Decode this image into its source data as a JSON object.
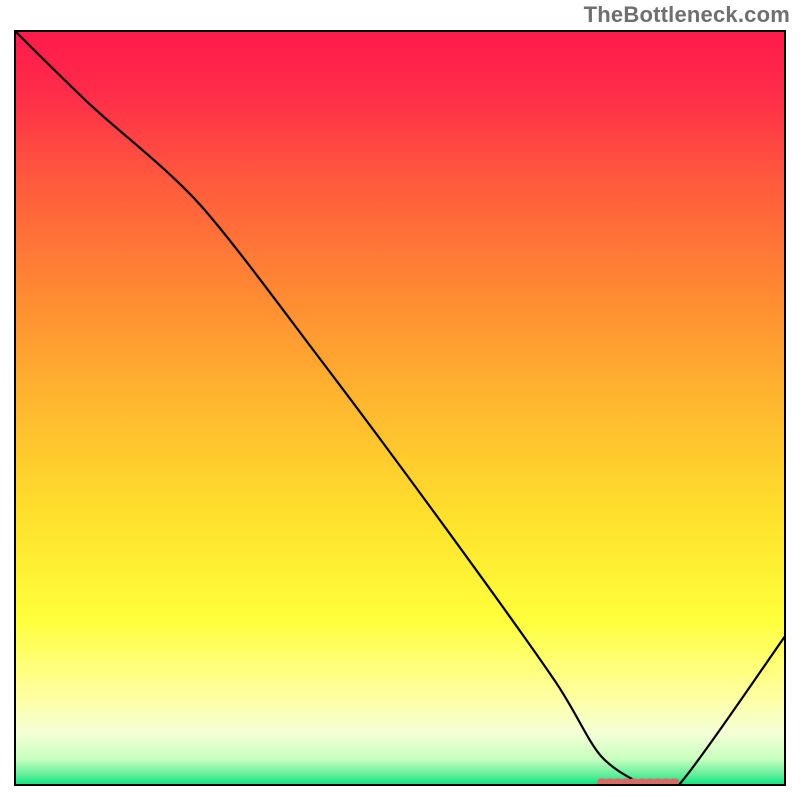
{
  "watermark": "TheBottleneck.com",
  "chart_data": {
    "type": "line",
    "title": "",
    "xlabel": "",
    "ylabel": "",
    "xlim": [
      0,
      100
    ],
    "ylim": [
      0,
      100
    ],
    "grid": false,
    "legend": false,
    "series": [
      {
        "name": "curve",
        "x": [
          0,
          10,
          24,
          40,
          56,
          70,
          76,
          82,
          86,
          100
        ],
        "y": [
          100,
          90,
          77,
          56,
          34,
          14,
          4,
          0,
          0,
          20
        ]
      }
    ],
    "marker": {
      "name": "optimum-range",
      "x_start": 76,
      "x_end": 86,
      "y": 0.0,
      "color": "#d86a63"
    },
    "gradient_stops": [
      {
        "offset": 0.0,
        "color": "#ff1a4b"
      },
      {
        "offset": 0.08,
        "color": "#ff2b4a"
      },
      {
        "offset": 0.2,
        "color": "#ff5a3d"
      },
      {
        "offset": 0.35,
        "color": "#ff8a33"
      },
      {
        "offset": 0.5,
        "color": "#ffb92f"
      },
      {
        "offset": 0.65,
        "color": "#ffe22d"
      },
      {
        "offset": 0.78,
        "color": "#ffff3b"
      },
      {
        "offset": 0.88,
        "color": "#ffffa0"
      },
      {
        "offset": 0.93,
        "color": "#f4ffd6"
      },
      {
        "offset": 0.965,
        "color": "#c7ffbe"
      },
      {
        "offset": 0.985,
        "color": "#61ee9b"
      },
      {
        "offset": 1.0,
        "color": "#00e47a"
      }
    ],
    "frame_color": "#000000"
  }
}
